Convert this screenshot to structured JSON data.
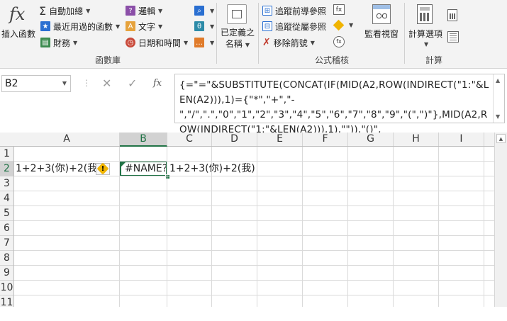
{
  "ribbon": {
    "insert_function": {
      "glyph": "fx",
      "label": "插入函數"
    },
    "autosum": "自動加總",
    "recently_used": "最近用過的函數",
    "financial": "財務",
    "logical": "邏輯",
    "text": "文字",
    "date_time": "日期和時間",
    "function_library_label": "函數庫",
    "defined_names": {
      "line1": "已定義之",
      "line2": "名稱"
    },
    "trace_precedents": "追蹤前導參照",
    "trace_dependents": "追蹤從屬參照",
    "remove_arrows": "移除箭號",
    "watch_window": "監看視窗",
    "formula_auditing_label": "公式稽核",
    "calc_options": "計算選項",
    "calculation_label": "計算"
  },
  "formula_bar": {
    "name_box": "B2",
    "cancel_icon": "✕",
    "enter_icon": "✓",
    "fx_icon": "fx",
    "formula": "{=\"=\"&SUBSTITUTE(CONCAT(IF(MID(A2,ROW(INDIRECT(\"1:\"&LEN(A2))),1)={\"*\",\"+\",\"-\",\"/\",\".\",\"0\",\"1\",\"2\",\"3\",\"4\",\"5\",\"6\",\"7\",\"8\",\"9\",\"(\",\")\"},MID(A2,ROW(INDIRECT(\"1:\"&LEN(A2))),1),\"\")),\"()\","
  },
  "grid": {
    "columns": [
      "A",
      "B",
      "C",
      "D",
      "E",
      "F",
      "G",
      "H",
      "I"
    ],
    "selected_column": "B",
    "rows": [
      "1",
      "2",
      "3",
      "4",
      "5",
      "6",
      "7",
      "8",
      "9",
      "10",
      "11"
    ],
    "selected_row": "2",
    "cells": {
      "A2": "1+2+3(你)+2(我)",
      "B2": "#NAME?",
      "C2": "1+2+3(你)+2(我)"
    },
    "error_button_icon": "!"
  },
  "colors": {
    "excel_green": "#217346",
    "warning": "#f0b400",
    "ribbon_bg": "#f3f3f3"
  }
}
